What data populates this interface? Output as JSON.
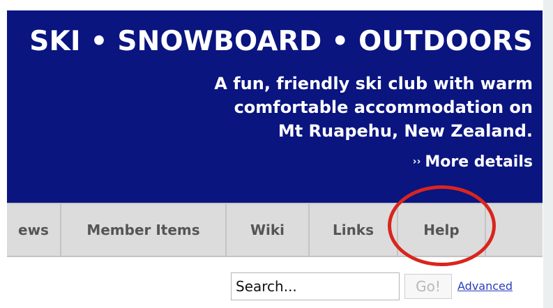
{
  "banner": {
    "tagline": "SKI • SNOWBOARD • OUTDOORS",
    "description_lines": [
      "A fun, friendly ski club with warm",
      "comfortable accommodation on",
      "Mt Ruapehu, New Zealand."
    ],
    "more_arrows": "››",
    "more_label": "More details",
    "background_color": "#0a1580"
  },
  "nav": {
    "items": [
      {
        "label": "ews"
      },
      {
        "label": "Member Items"
      },
      {
        "label": "Wiki"
      },
      {
        "label": "Links"
      },
      {
        "label": "Help",
        "highlighted": true
      }
    ],
    "highlight_color": "#d9251e"
  },
  "search": {
    "value": "Search...",
    "go_label": "Go!",
    "advanced_label": "Advanced"
  }
}
